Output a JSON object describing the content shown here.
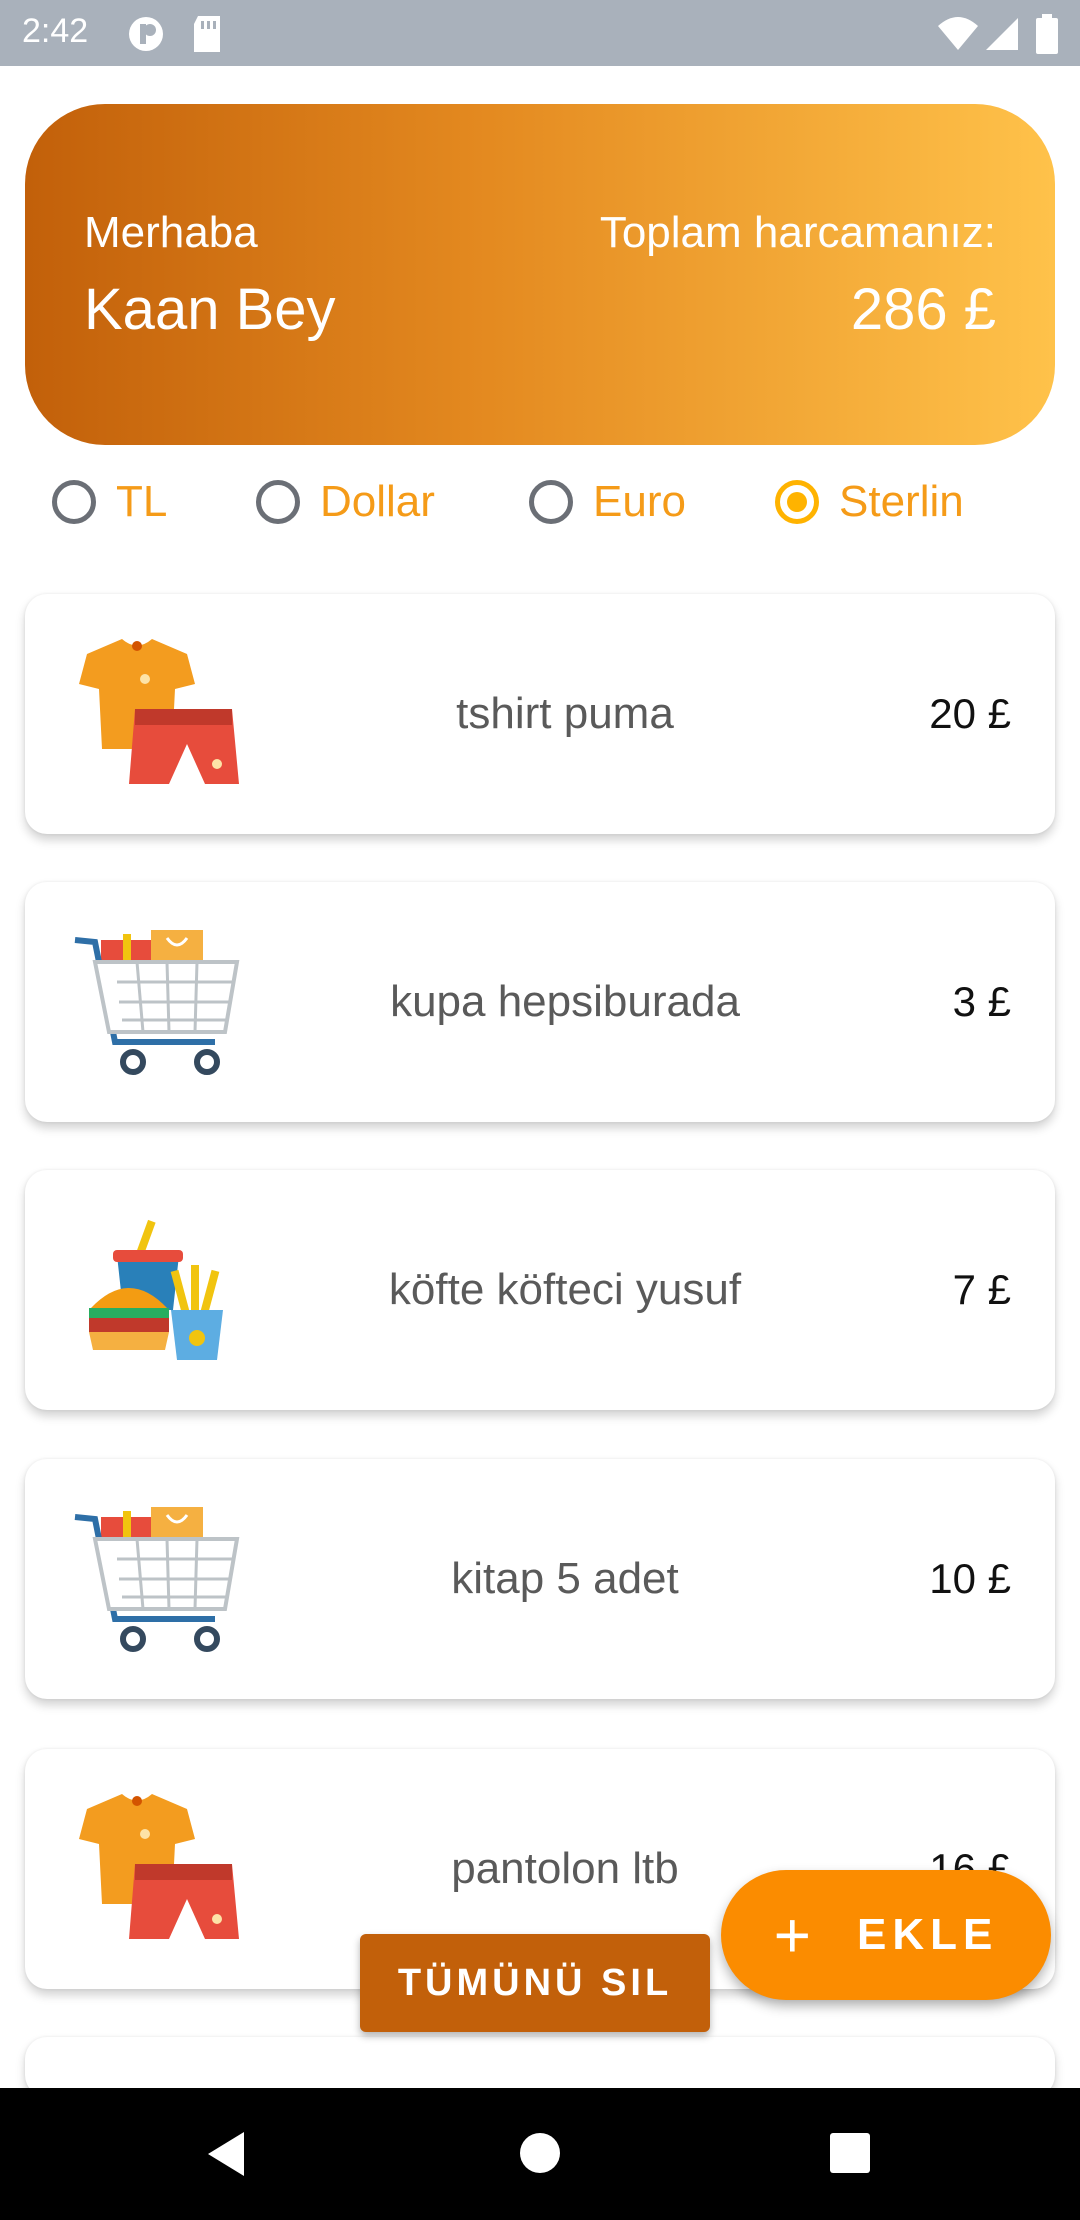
{
  "status_bar": {
    "time": "2:42"
  },
  "header": {
    "greeting": "Merhaba",
    "user_name": "Kaan  Bey",
    "total_label": "Toplam harcamanız:",
    "total_value": "286 £"
  },
  "currency_options": [
    {
      "label": "TL",
      "selected": false
    },
    {
      "label": "Dollar",
      "selected": false
    },
    {
      "label": "Euro",
      "selected": false
    },
    {
      "label": "Sterlin",
      "selected": true
    }
  ],
  "expenses": [
    {
      "title": "tshirt puma",
      "amount": "20 £",
      "icon": "clothes-icon"
    },
    {
      "title": "kupa hepsiburada",
      "amount": "3 £",
      "icon": "shopping-cart-icon"
    },
    {
      "title": "köfte köfteci yusuf",
      "amount": "7 £",
      "icon": "fast-food-icon"
    },
    {
      "title": "kitap 5 adet",
      "amount": "10 £",
      "icon": "shopping-cart-icon"
    },
    {
      "title": "pantolon ltb",
      "amount": "16 £",
      "icon": "clothes-icon"
    }
  ],
  "actions": {
    "delete_all_label": "TÜMÜNÜ SIL",
    "add_label": "EKLE",
    "add_icon": "plus-icon"
  },
  "colors": {
    "accent": "#fb8c00",
    "dark_orange": "#c2600a",
    "radio_selected": "#ffb300",
    "radio_label": "#f59b18"
  }
}
